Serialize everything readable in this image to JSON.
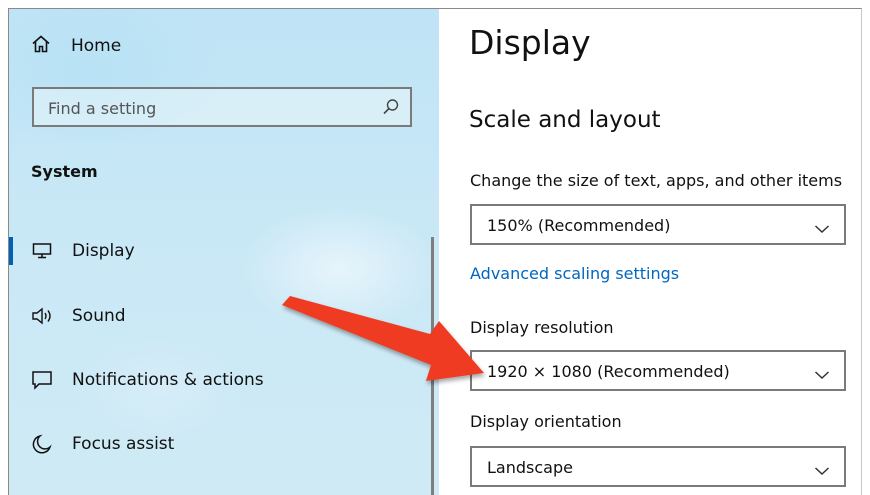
{
  "sidebar": {
    "home_label": "Home",
    "search": {
      "placeholder": "Find a setting"
    },
    "section_label": "System",
    "items": [
      {
        "label": "Display",
        "icon": "monitor-icon",
        "selected": true
      },
      {
        "label": "Sound",
        "icon": "speaker-icon",
        "selected": false
      },
      {
        "label": "Notifications & actions",
        "icon": "notifications-icon",
        "selected": false
      },
      {
        "label": "Focus assist",
        "icon": "moon-icon",
        "selected": false
      }
    ]
  },
  "main": {
    "title": "Display",
    "section": "Scale and layout",
    "scale": {
      "label": "Change the size of text, apps, and other items",
      "value": "150% (Recommended)"
    },
    "advanced_link": "Advanced scaling settings",
    "resolution": {
      "label": "Display resolution",
      "value": "1920 × 1080 (Recommended)"
    },
    "orientation": {
      "label": "Display orientation",
      "value": "Landscape"
    }
  },
  "colors": {
    "accent": "#0063b1",
    "link": "#0067c0",
    "sidebar_bg": "#c9e8f6",
    "annotation_arrow": "#ee3b24"
  }
}
